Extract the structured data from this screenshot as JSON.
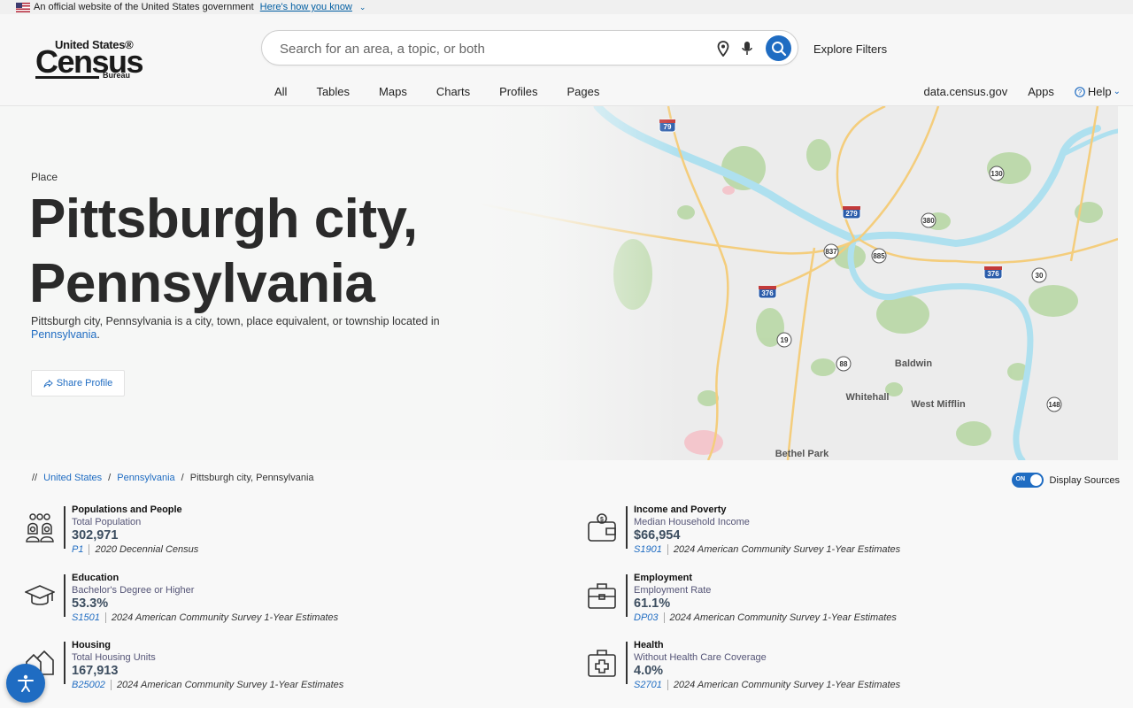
{
  "gov_banner": {
    "text": "An official website of the United States government",
    "link": "Here's how you know"
  },
  "logo": {
    "top": "United States®",
    "main": "Census",
    "bureau": "Bureau"
  },
  "search": {
    "placeholder": "Search for an area, a topic, or both",
    "value": "",
    "explore_filters": "Explore Filters"
  },
  "nav": {
    "tabs": [
      "All",
      "Tables",
      "Maps",
      "Charts",
      "Profiles",
      "Pages"
    ],
    "right": {
      "data": "data.census.gov",
      "apps": "Apps",
      "help": "Help"
    }
  },
  "hero": {
    "type": "Place",
    "title": "Pittsburgh city, Pennsylvania",
    "desc_prefix": "Pittsburgh city, Pennsylvania is a city, town, place equivalent, or township located in ",
    "desc_link": "Pennsylvania",
    "desc_suffix": ".",
    "share": "Share Profile"
  },
  "map": {
    "labels": [
      "Baldwin",
      "Whitehall",
      "West Mifflin",
      "Bethel Park"
    ],
    "shields": [
      "79",
      "279",
      "376",
      "376",
      "376",
      "130",
      "380",
      "837",
      "885",
      "19",
      "88",
      "148",
      "30"
    ]
  },
  "breadcrumb": {
    "sep": "//",
    "items": [
      "United States",
      "Pennsylvania",
      "Pittsburgh city, Pennsylvania"
    ]
  },
  "display_sources": {
    "on": "ON",
    "label": "Display Sources"
  },
  "stats": [
    {
      "category": "Populations and People",
      "measure": "Total Population",
      "value": "302,971",
      "code": "P1",
      "source": "2020 Decennial Census",
      "icon": "people-icon"
    },
    {
      "category": "Income and Poverty",
      "measure": "Median Household Income",
      "value": "$66,954",
      "code": "S1901",
      "source": "2024 American Community Survey 1-Year Estimates",
      "icon": "wallet-icon"
    },
    {
      "category": "Education",
      "measure": "Bachelor's Degree or Higher",
      "value": "53.3%",
      "code": "S1501",
      "source": "2024 American Community Survey 1-Year Estimates",
      "icon": "graduation-cap-icon"
    },
    {
      "category": "Employment",
      "measure": "Employment Rate",
      "value": "61.1%",
      "code": "DP03",
      "source": "2024 American Community Survey 1-Year Estimates",
      "icon": "briefcase-icon"
    },
    {
      "category": "Housing",
      "measure": "Total Housing Units",
      "value": "167,913",
      "code": "B25002",
      "source": "2024 American Community Survey 1-Year Estimates",
      "icon": "houses-icon"
    },
    {
      "category": "Health",
      "measure": "Without Health Care Coverage",
      "value": "4.0%",
      "code": "S2701",
      "source": "2024 American Community Survey 1-Year Estimates",
      "icon": "medical-kit-icon"
    }
  ],
  "colors": {
    "accent": "#1f6cc2",
    "text": "#222222",
    "value": "#3d4e60"
  }
}
